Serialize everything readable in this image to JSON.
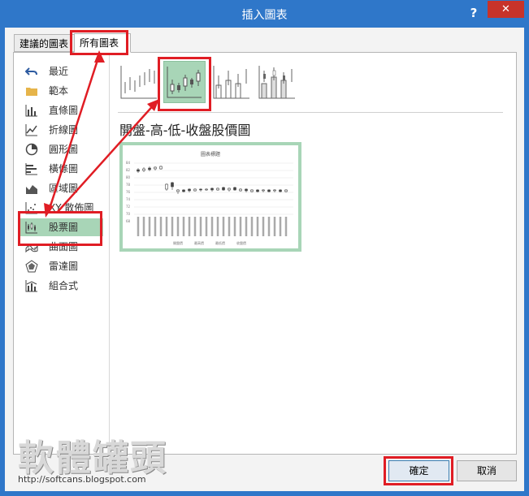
{
  "window": {
    "title": "插入圖表",
    "help": "?",
    "close": "✕"
  },
  "tabs": [
    {
      "label": "建議的圖表"
    },
    {
      "label": "所有圖表"
    }
  ],
  "sidebar": {
    "items": [
      {
        "label": "最近",
        "icon": "undo-icon"
      },
      {
        "label": "範本",
        "icon": "folder-icon"
      },
      {
        "label": "直條圖",
        "icon": "column-chart-icon"
      },
      {
        "label": "折線圖",
        "icon": "line-chart-icon"
      },
      {
        "label": "圓形圖",
        "icon": "pie-chart-icon"
      },
      {
        "label": "橫條圖",
        "icon": "bar-chart-icon"
      },
      {
        "label": "區域圖",
        "icon": "area-chart-icon"
      },
      {
        "label": "XY 散佈圖",
        "icon": "scatter-chart-icon"
      },
      {
        "label": "股票圖",
        "icon": "stock-chart-icon"
      },
      {
        "label": "曲面圖",
        "icon": "surface-chart-icon"
      },
      {
        "label": "雷達圖",
        "icon": "radar-chart-icon"
      },
      {
        "label": "組合式",
        "icon": "combo-chart-icon"
      }
    ],
    "selected": "股票圖"
  },
  "main": {
    "subtype_title": "開盤-高-低-收盤股價圖",
    "preview": {
      "chart_title": "圖表標題",
      "y_ticks": [
        "84",
        "82",
        "80",
        "78",
        "76",
        "74",
        "72",
        "70",
        "68"
      ],
      "legend": [
        "開盤價",
        "最高價",
        "最低價",
        "收盤價"
      ]
    }
  },
  "buttons": {
    "ok": "確定",
    "cancel": "取消"
  },
  "watermark": {
    "text": "軟體罐頭",
    "url": "http://softcans.blogspot.com"
  },
  "colors": {
    "titlebar": "#2f77c9",
    "selection": "#a8d5b7",
    "highlight": "#e01d24",
    "close": "#c7332a"
  }
}
